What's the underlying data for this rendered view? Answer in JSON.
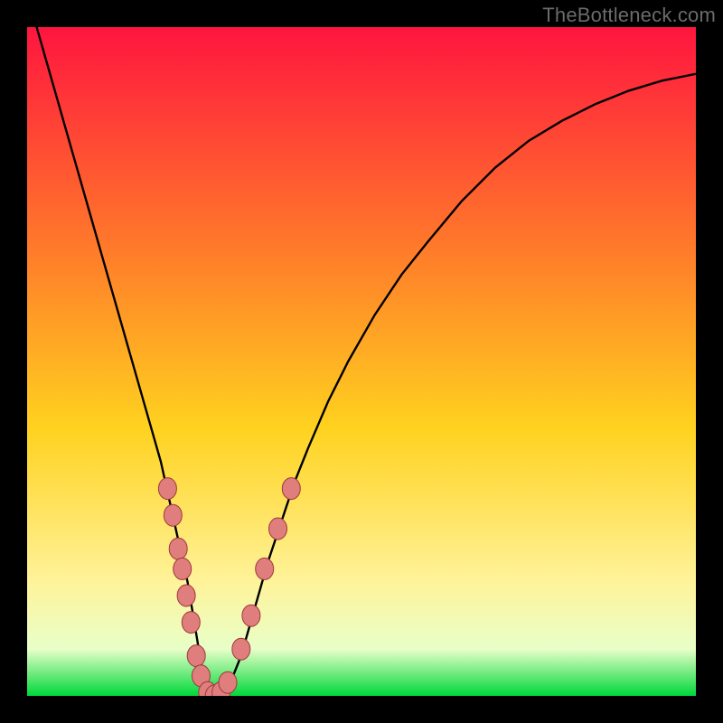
{
  "watermark": "TheBottleneck.com",
  "colors": {
    "bg": "#000000",
    "gradient_top": "#ff153f",
    "gradient_upper_mid": "#ff7a2a",
    "gradient_mid": "#ffd21f",
    "gradient_lower_mid": "#fff39a",
    "gradient_near_bottom": "#e8ffc8",
    "gradient_bottom": "#00d83a",
    "curve": "#000000",
    "marker_fill": "#e07d7d",
    "marker_stroke": "#9c3a3a"
  },
  "chart_data": {
    "type": "line",
    "title": "",
    "xlabel": "",
    "ylabel": "",
    "xlim": [
      0,
      100
    ],
    "ylim": [
      0,
      100
    ],
    "curve": {
      "x": [
        0,
        2,
        4,
        6,
        8,
        10,
        12,
        14,
        16,
        18,
        20,
        22,
        24,
        25,
        26,
        27,
        28,
        29,
        30,
        32,
        34,
        36,
        38,
        40,
        42,
        45,
        48,
        52,
        56,
        60,
        65,
        70,
        75,
        80,
        85,
        90,
        95,
        100
      ],
      "y": [
        105,
        98,
        91,
        84,
        77,
        70,
        63,
        56,
        49,
        42,
        35,
        26,
        17,
        11,
        5,
        1,
        0,
        0,
        1,
        6,
        13,
        20,
        26,
        32,
        37,
        44,
        50,
        57,
        63,
        68,
        74,
        79,
        83,
        86,
        88.5,
        90.5,
        92,
        93
      ]
    },
    "markers": [
      {
        "x": 21.0,
        "y": 31
      },
      {
        "x": 21.8,
        "y": 27
      },
      {
        "x": 22.6,
        "y": 22
      },
      {
        "x": 23.2,
        "y": 19
      },
      {
        "x": 23.8,
        "y": 15
      },
      {
        "x": 24.5,
        "y": 11
      },
      {
        "x": 25.3,
        "y": 6
      },
      {
        "x": 26.0,
        "y": 3
      },
      {
        "x": 27.0,
        "y": 0.5
      },
      {
        "x": 28.0,
        "y": 0
      },
      {
        "x": 29.0,
        "y": 0.5
      },
      {
        "x": 30.0,
        "y": 2
      },
      {
        "x": 32.0,
        "y": 7
      },
      {
        "x": 33.5,
        "y": 12
      },
      {
        "x": 35.5,
        "y": 19
      },
      {
        "x": 37.5,
        "y": 25
      },
      {
        "x": 39.5,
        "y": 31
      }
    ]
  }
}
